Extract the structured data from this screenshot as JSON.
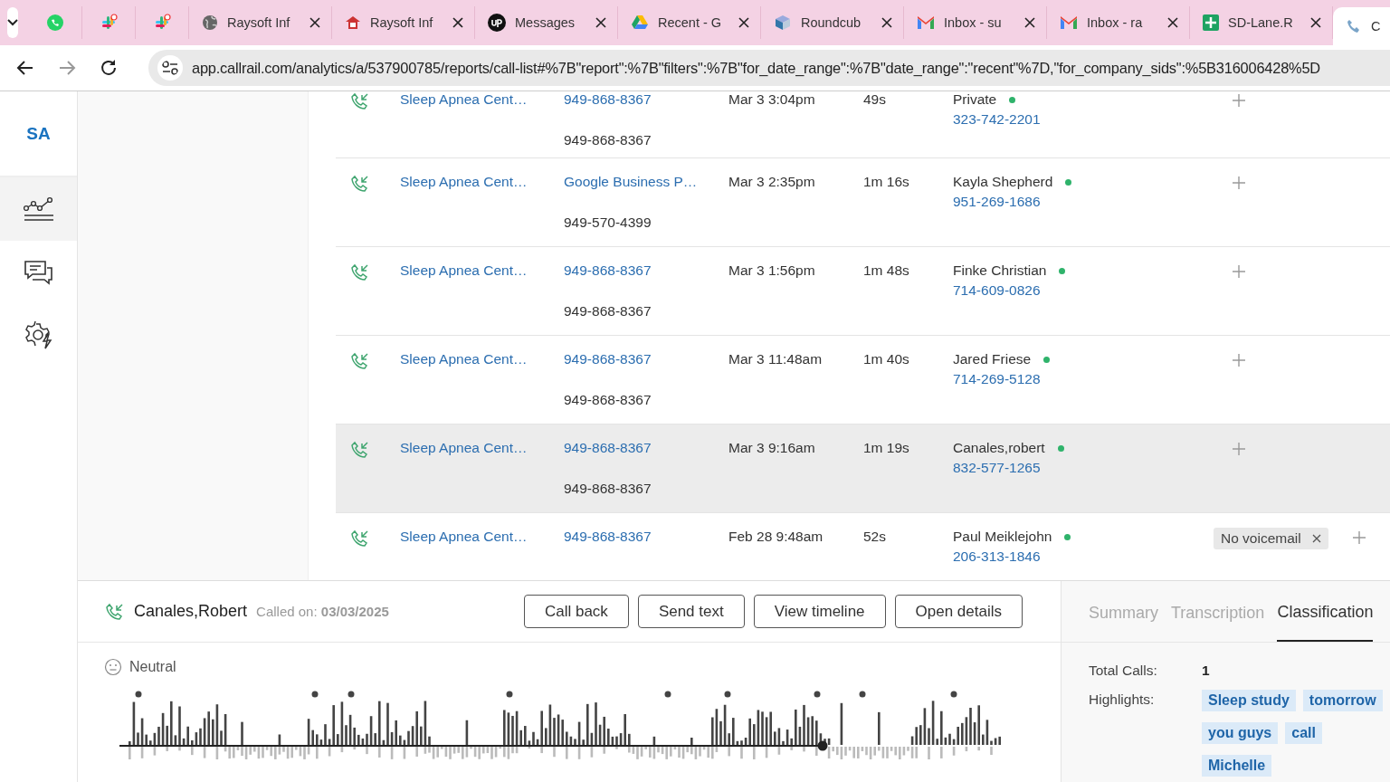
{
  "browser": {
    "pinned_tabs": [
      {
        "selected": false
      },
      {
        "selected": false
      },
      {
        "selected": false
      }
    ],
    "tabs": [
      {
        "title": "Raysoft Inf",
        "selected": false
      },
      {
        "title": "Raysoft Inf",
        "selected": false
      },
      {
        "title": "Messages",
        "selected": false
      },
      {
        "title": "Recent - G",
        "selected": false
      },
      {
        "title": "Roundcub",
        "selected": false
      },
      {
        "title": "Inbox - su",
        "selected": false
      },
      {
        "title": "Inbox - ra",
        "selected": false
      },
      {
        "title": "SD-Lane.R",
        "selected": false
      },
      {
        "title": "C",
        "selected": true
      }
    ],
    "url": "app.callrail.com/analytics/a/537900785/reports/call-list#%7B\"report\":%7B\"filters\":%7B\"for_date_range\":%7B\"date_range\":\"recent\"%7D,\"for_company_sids\":%5B316006428%5D"
  },
  "sidebar": {
    "account": "SA",
    "items": [
      {
        "selected": true
      },
      {
        "selected": false
      },
      {
        "selected": false
      }
    ]
  },
  "calls": [
    {
      "source": "Sleep Apnea Cent…",
      "tracking": "949-868-8367",
      "number": "949-868-8367",
      "date": "Mar 3 3:04pm",
      "duration": "49s",
      "caller": "Private",
      "caller_phone": "323-742-2201",
      "selected": false
    },
    {
      "source": "Sleep Apnea Cent…",
      "tracking": "Google Business P…",
      "number": "949-570-4399",
      "date": "Mar 3 2:35pm",
      "duration": "1m 16s",
      "caller": "Kayla Shepherd",
      "caller_phone": "951-269-1686",
      "selected": false
    },
    {
      "source": "Sleep Apnea Cent…",
      "tracking": "949-868-8367",
      "number": "949-868-8367",
      "date": "Mar 3 1:56pm",
      "duration": "1m 48s",
      "caller": "Finke Christian",
      "caller_phone": "714-609-0826",
      "selected": false
    },
    {
      "source": "Sleep Apnea Cent…",
      "tracking": "949-868-8367",
      "number": "949-868-8367",
      "date": "Mar 3 11:48am",
      "duration": "1m 40s",
      "caller": "Jared Friese",
      "caller_phone": "714-269-5128",
      "selected": false
    },
    {
      "source": "Sleep Apnea Cent…",
      "tracking": "949-868-8367",
      "number": "949-868-8367",
      "date": "Mar 3 9:16am",
      "duration": "1m 19s",
      "caller": "Canales,robert",
      "caller_phone": "832-577-1265",
      "selected": true
    },
    {
      "source": "Sleep Apnea Cent…",
      "tracking": "949-868-8367",
      "date": "Feb 28 9:48am",
      "duration": "52s",
      "caller": "Paul Meiklejohn",
      "caller_phone": "206-313-1846",
      "tags": [
        "No voicemail"
      ],
      "selected": false
    }
  ],
  "detail": {
    "caller": "Canales,Robert",
    "called_on": "Called on: **03/03/2025**",
    "buttons": [
      "Call back",
      "Send text",
      "View timeline",
      "Open details"
    ],
    "sentiment": "Neutral",
    "tabs": [
      {
        "label": "Summary",
        "selected": false
      },
      {
        "label": "Transcription",
        "selected": false
      },
      {
        "label": "Classification",
        "selected": true
      }
    ],
    "fields": [
      {
        "label": "Total Calls:",
        "value": "1"
      },
      {
        "label": "Highlights:",
        "tags": [
          "Sleep study",
          "tomorrow",
          "you guys",
          "call",
          "Michelle"
        ]
      }
    ]
  }
}
